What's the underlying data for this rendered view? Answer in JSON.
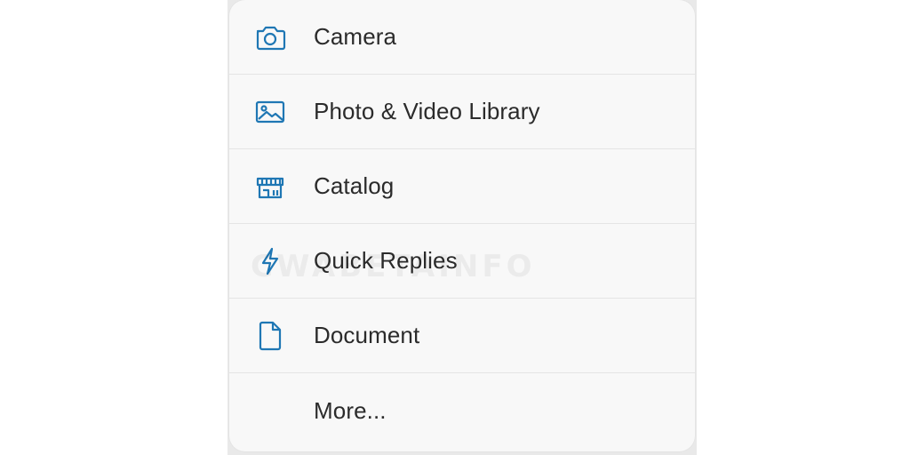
{
  "menu": {
    "items": [
      {
        "label": "Camera",
        "icon": "camera-icon"
      },
      {
        "label": "Photo & Video Library",
        "icon": "photo-library-icon"
      },
      {
        "label": "Catalog",
        "icon": "storefront-icon"
      },
      {
        "label": "Quick Replies",
        "icon": "lightning-bolt-icon"
      },
      {
        "label": "Document",
        "icon": "document-icon"
      },
      {
        "label": "More..."
      }
    ]
  },
  "watermark": "CWABETAINFO",
  "colors": {
    "icon": "#1f77b4",
    "text": "#2b2b2b",
    "menu_bg": "#f8f8f8",
    "divider": "#e5e5e5"
  }
}
